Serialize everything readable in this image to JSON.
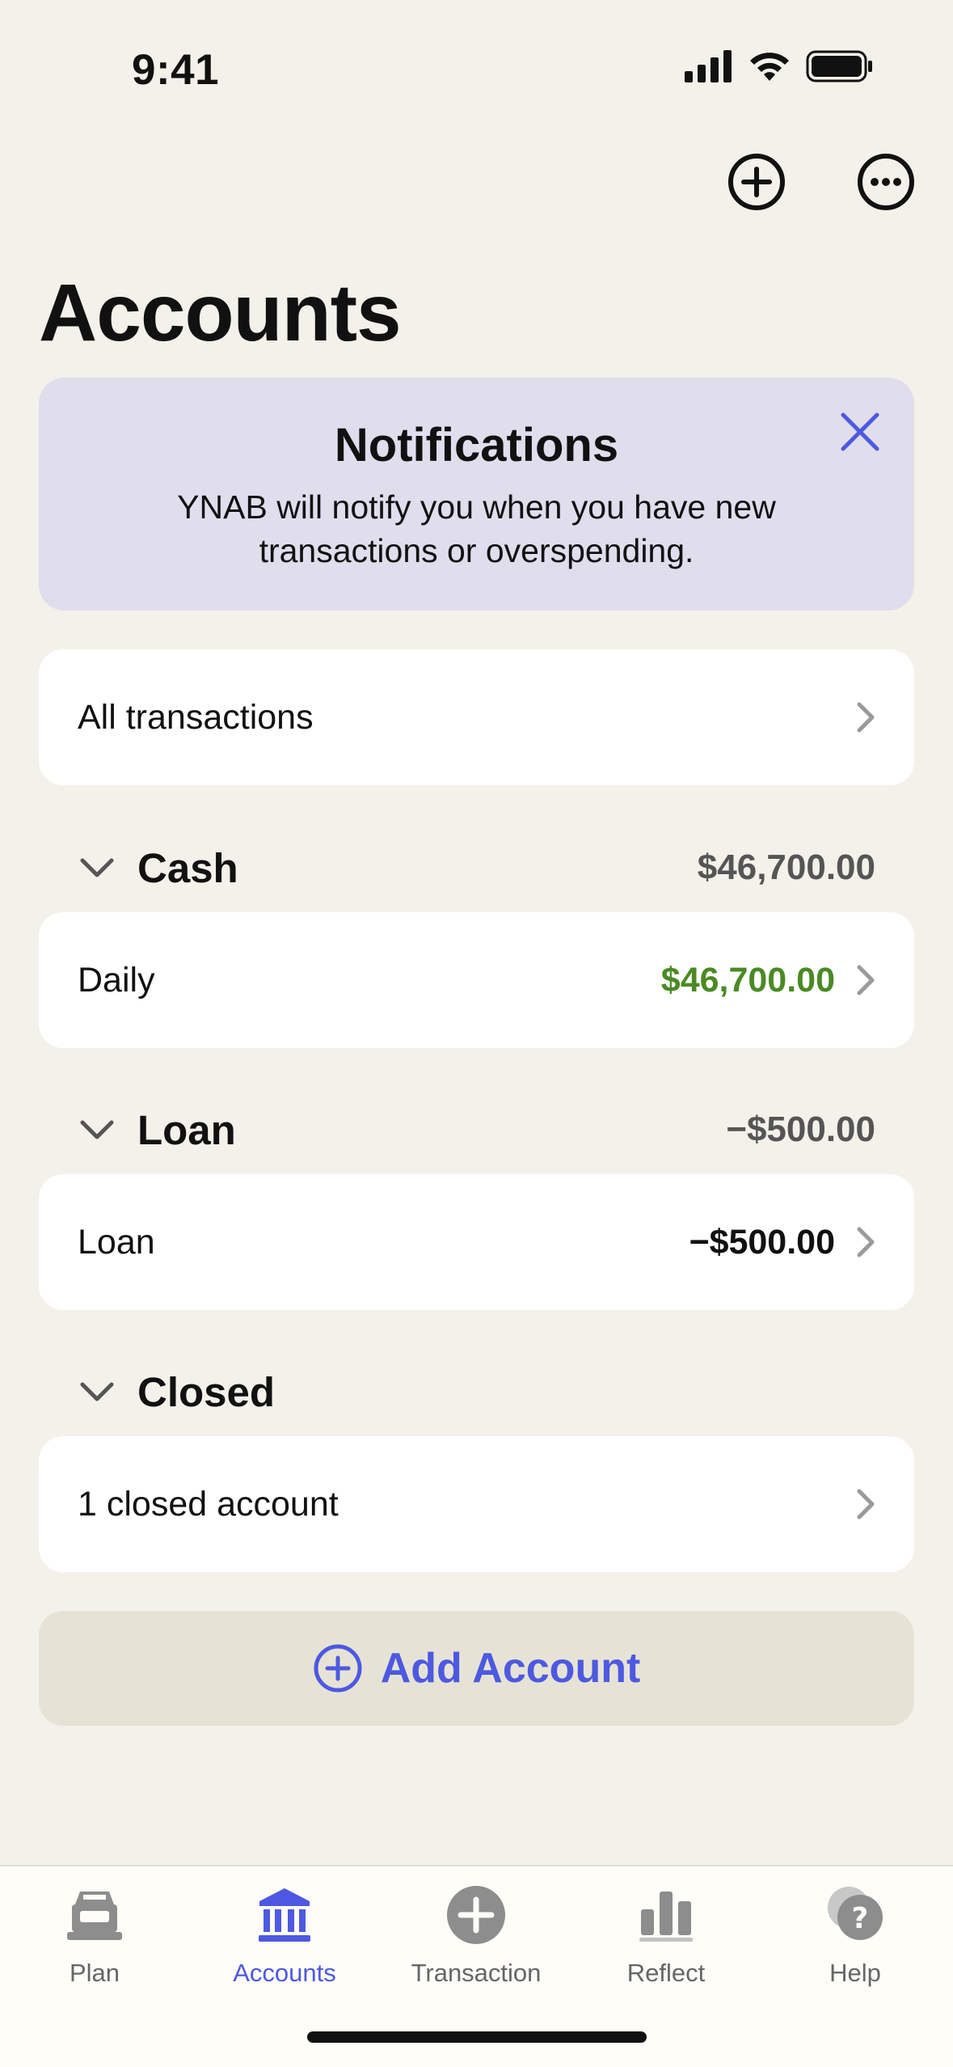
{
  "status_bar": {
    "time": "9:41"
  },
  "header": {
    "title": "Accounts"
  },
  "notification": {
    "title": "Notifications",
    "body": "YNAB will notify you when you have new transactions or overspending."
  },
  "all_transactions": {
    "label": "All transactions"
  },
  "groups": {
    "cash": {
      "title": "Cash",
      "total": "$46,700.00",
      "account": {
        "name": "Daily",
        "balance": "$46,700.00",
        "balance_color": "#4a8a24"
      }
    },
    "loan": {
      "title": "Loan",
      "total": "−$500.00",
      "account": {
        "name": "Loan",
        "balance": "−$500.00",
        "balance_color": "#111111"
      }
    },
    "closed": {
      "title": "Closed",
      "summary": "1 closed account"
    }
  },
  "add_account": {
    "label": "Add Account"
  },
  "tabs": [
    {
      "label": "Plan",
      "icon": "plan-icon",
      "active": false
    },
    {
      "label": "Accounts",
      "icon": "bank-icon",
      "active": true
    },
    {
      "label": "Transaction",
      "icon": "plus-circle-icon",
      "active": false
    },
    {
      "label": "Reflect",
      "icon": "bar-chart-icon",
      "active": false
    },
    {
      "label": "Help",
      "icon": "help-bubble-icon",
      "active": false
    }
  ],
  "colors": {
    "accent": "#4d59e0",
    "positive": "#4a8a24",
    "background": "#f3f1ea"
  }
}
